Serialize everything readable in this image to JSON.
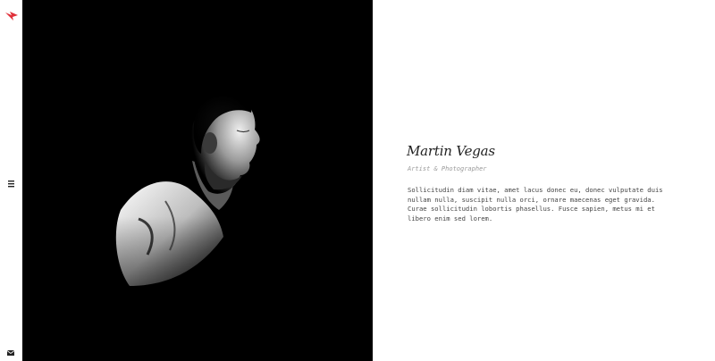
{
  "nav": {
    "logo": "bird-logo-icon",
    "menu_icon": "hamburger-menu-icon",
    "contact_icon": "envelope-icon",
    "accent_color": "#e0303a"
  },
  "photo": {
    "subject": "portrait",
    "background_color": "#000000"
  },
  "profile": {
    "name": "Martin Vegas",
    "role": "Artist & Photographer",
    "description": "Sollicitudin diam vitae, amet lacus donec eu, donec vulputate duis nullam nulla, suscipit nulla orci, ornare maecenas eget gravida. Curae sollicitudin lobortis phasellus. Fusce sapien, metus mi et libero enim sed lorem."
  }
}
